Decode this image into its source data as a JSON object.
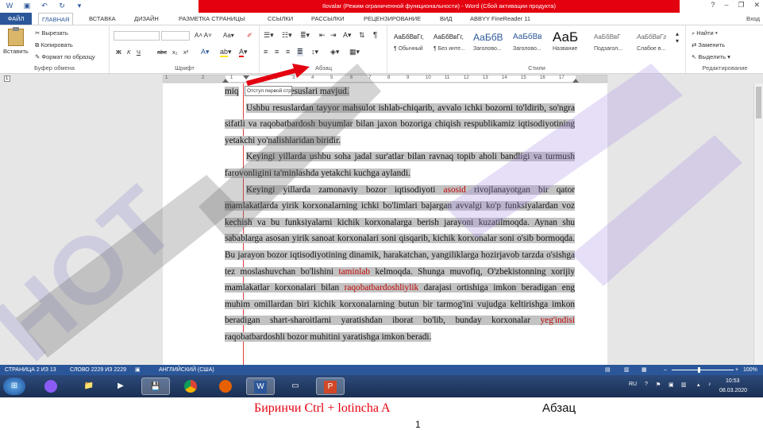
{
  "titlebar": {
    "title": "Ilovalar (Режим ограниченной функциональности) - Word (Сбой активации продукта)",
    "signin": "Вход",
    "help": "?",
    "minimize": "–",
    "restore": "❐",
    "close": "✕"
  },
  "tabs": [
    {
      "label": "ФАЙЛ"
    },
    {
      "label": "ГЛАВНАЯ"
    },
    {
      "label": "ВСТАВКА"
    },
    {
      "label": "ДИЗАЙН"
    },
    {
      "label": "РАЗМЕТКА СТРАНИЦЫ"
    },
    {
      "label": "ССЫЛКИ"
    },
    {
      "label": "РАССЫЛКИ"
    },
    {
      "label": "РЕЦЕНЗИРОВАНИЕ"
    },
    {
      "label": "ВИД"
    },
    {
      "label": "ABBYY FineReader 11"
    }
  ],
  "ribbon": {
    "clipboard": {
      "paste": "Вставить",
      "cut": "Вырезать",
      "copy": "Копировать",
      "format_painter": "Формат по образцу",
      "label": "Буфер обмена"
    },
    "font": {
      "label": "Шрифт",
      "bold": "Ж",
      "italic": "К",
      "underline": "Ч",
      "strike": "abc",
      "sub": "x₂",
      "sup": "x²"
    },
    "paragraph": {
      "label": "Абзац",
      "pilcrow": "¶"
    },
    "styles": {
      "label": "Стили",
      "items": [
        {
          "sample": "АаБбВвГг,",
          "name": "¶ Обычный"
        },
        {
          "sample": "АаБбВвГг,",
          "name": "¶ Без инте..."
        },
        {
          "sample": "АаБбВ",
          "name": "Заголово..."
        },
        {
          "sample": "АаБбВв",
          "name": "Заголово..."
        },
        {
          "sample": "АаБ",
          "name": "Название"
        },
        {
          "sample": "АаБбВвГ",
          "name": "Подзагол..."
        },
        {
          "sample": "АаБбВвГг",
          "name": "Слабое в..."
        }
      ]
    },
    "editing": {
      "label": "Редактирование",
      "find": "Найти",
      "replace": "Заменить",
      "select": "Выделить"
    }
  },
  "ruler": {
    "numbers": [
      "1",
      "2",
      "1",
      "1",
      "2",
      "3",
      "4",
      "5",
      "6",
      "7",
      "8",
      "9",
      "10",
      "11",
      "12",
      "13",
      "14",
      "15",
      "16",
      "17"
    ]
  },
  "document": {
    "tooltip": "Отступ первой строки",
    "line0_a": "miq",
    "line0_b": "ashyo resuslari mavjud.",
    "p1": "Ushbu resuslardan tayyor mahsulot ishlab-chiqarib, avvalo ichki bozorni to'ldirib, so'ngra sifatli va raqobatbardosh buyumlar bilan jaxon bozoriga chiqish respublikamiz iqtisodiyotining yetakchi yo'nalishlaridan biridir.",
    "p2": "Keyingi yillarda ushbu soha jadal sur'atlar bilan ravnaq topib aholi bandligi va turmush farovonligini ta'minlashda yetakchi kuchga aylandi.",
    "p3_a": "Keyingi yillarda zamonaviy bozor iqtisodiyoti ",
    "p3_red1": "asosid",
    "p3_b": " rivojlanayotgan bir qator mamlakatlarda yirik korxonalarning ichki bo'limlari bajargan avvalgi ko'p funksiyalardan voz kechish va bu funksiyalarni kichik korxonalarga berish jarayoni kuzatilmoqda. Aynan shu sabablarga asosan yirik sanoat korxonalari soni qisqarib, kichik korxonalar soni o'sib bormoqda. Bu jarayon bozor iqtisodiyotining dinamik, harakatchan, yangiliklarga hozirjavob tarzda o'sishga tez moslashuvchan bo'lishini ",
    "p3_red2": "taminlab",
    "p3_c": " kelmoqda. Shunga muvofiq, O'zbekistonning xorijiy mamlakatlar korxonalari bilan ",
    "p3_red3": "raqobatbardoshliylik",
    "p3_d": " darajasi ortishiga imkon beradigan eng muhim omillardan biri kichik korxonalarning butun bir tarmog'ini vujudga keltirishga imkon beradigan shart-sharoitlarni yaratishdan iborat bo'lib, bunday korxonalar ",
    "p3_red4": "yeg'indisi",
    "p3_e": " raqobatbardoshli bozor muhitini yaratishga imkon beradi."
  },
  "statusbar": {
    "page": "СТРАНИЦА 2 ИЗ 13",
    "words": "СЛОВО 2229 ИЗ 2229",
    "lang": "АНГЛИЙСКИЙ (США)",
    "zoom": "100%"
  },
  "taskbar": {
    "lang": "RU",
    "time": "10:53",
    "date": "08.03.2020"
  },
  "caption": {
    "red": "Биринчи Ctrl + lotincha A",
    "black": "Абзац",
    "page_number": "1"
  },
  "colors": {
    "brand_blue": "#2b579a",
    "title_red": "#e3000f",
    "selection": "#c3c3c3"
  }
}
